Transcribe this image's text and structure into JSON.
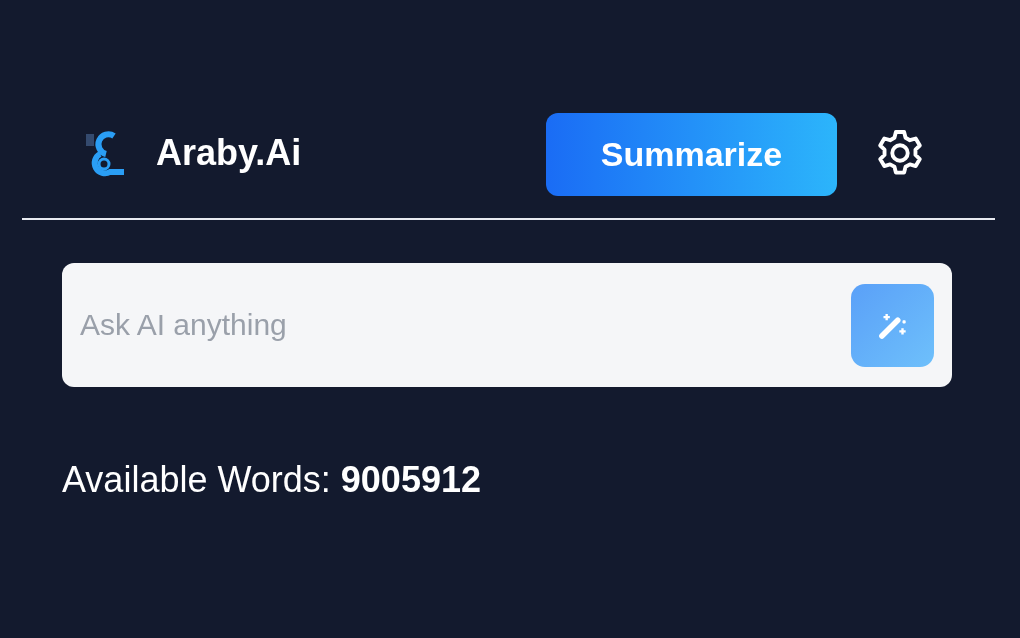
{
  "header": {
    "brand": "Araby.Ai",
    "summarize_button": "Summarize"
  },
  "ask_field": {
    "placeholder": "Ask AI anything"
  },
  "available_words": "Available Words: **9005912**"
}
